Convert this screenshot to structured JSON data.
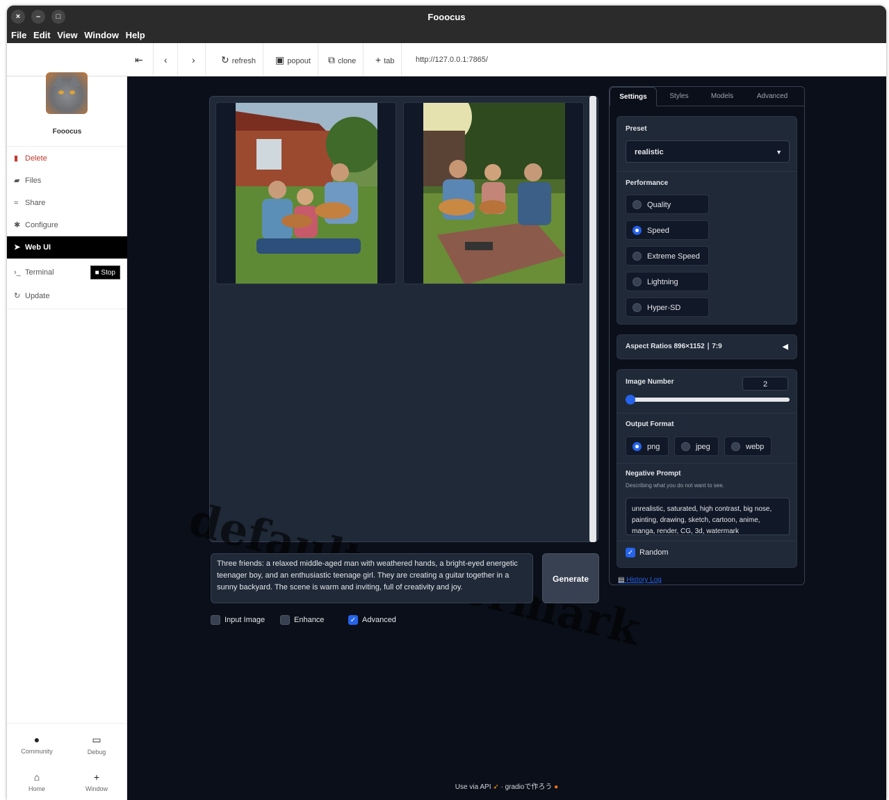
{
  "window": {
    "title": "Fooocus",
    "close": "×",
    "minimize": "–",
    "maximize": "□"
  },
  "menu": [
    "File",
    "Edit",
    "View",
    "Window",
    "Help"
  ],
  "toolbar": {
    "back_label": "",
    "refresh_label": "refresh",
    "popout_label": "popout",
    "clone_label": "clone",
    "tab_label": "tab",
    "url": "http://127.0.0.1:7865/"
  },
  "sidebar": {
    "app_name": "Fooocus",
    "items": [
      {
        "label": "Delete",
        "icon": "trash-icon"
      },
      {
        "label": "Files",
        "icon": "folder-icon"
      },
      {
        "label": "Share",
        "icon": "wifi-icon"
      },
      {
        "label": "Configure",
        "icon": "gear-icon"
      },
      {
        "label": "Web UI",
        "icon": "rocket-icon"
      },
      {
        "label": "Terminal",
        "icon": "terminal-icon"
      },
      {
        "label": "Update",
        "icon": "refresh-icon"
      }
    ],
    "stop_label": "Stop",
    "bottom": [
      {
        "label": "Community",
        "icon": "globe-icon"
      },
      {
        "label": "Debug",
        "icon": "terminal-box-icon"
      },
      {
        "label": "Home",
        "icon": "home-icon"
      },
      {
        "label": "Window",
        "icon": "plus-icon"
      }
    ]
  },
  "gallery": {
    "watermark": "default watermark"
  },
  "prompt": {
    "text": "Three friends: a relaxed middle-aged man with weathered hands, a bright-eyed energetic teenager boy, and an enthusiastic teenage girl. They are creating a guitar together in a sunny backyard. The scene is warm and inviting, full of creativity and joy."
  },
  "generate_label": "Generate",
  "options": [
    {
      "label": "Input Image",
      "checked": false
    },
    {
      "label": "Enhance",
      "checked": false
    },
    {
      "label": "Advanced",
      "checked": true
    }
  ],
  "tabs": [
    "Settings",
    "Styles",
    "Models",
    "Advanced"
  ],
  "settings": {
    "preset_label": "Preset",
    "preset_value": "realistic",
    "performance_label": "Performance",
    "performance_options": [
      "Quality",
      "Speed",
      "Extreme Speed",
      "Lightning",
      "Hyper-SD"
    ],
    "performance_selected": "Speed",
    "aspect_label": "Aspect Ratios 896×1152 ∣ 7:9",
    "image_number_label": "Image Number",
    "image_number_value": "2",
    "image_number_fraction": 0.03,
    "output_format_label": "Output Format",
    "output_formats": [
      "png",
      "jpeg",
      "webp"
    ],
    "output_selected": "png",
    "negative_label": "Negative Prompt",
    "negative_hint": "Describing what you do not want to see.",
    "negative_text": "unrealistic, saturated, high contrast, big nose, painting, drawing, sketch, cartoon, anime, manga, render, CG, 3d, watermark",
    "random_label": "Random",
    "random_checked": true,
    "history_label": "History Log"
  },
  "footer": {
    "api": "Use via API",
    "sep": "·",
    "gradio": "gradioで作ろう"
  }
}
